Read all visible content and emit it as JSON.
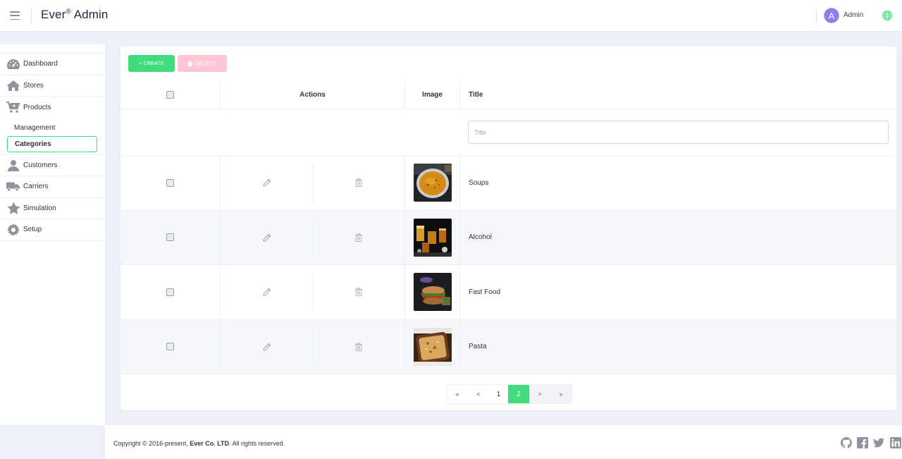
{
  "header": {
    "logo": "Ever",
    "logo_mark": "®",
    "logo_suffix": " Admin",
    "avatar_letter": "A",
    "user_name": "Admin"
  },
  "sidebar": {
    "items": [
      {
        "label": "Dashboard",
        "icon": "dashboard-icon"
      },
      {
        "label": "Stores",
        "icon": "home-icon"
      },
      {
        "label": "Products",
        "icon": "cart-icon"
      },
      {
        "label": "Customers",
        "icon": "person-icon"
      },
      {
        "label": "Carriers",
        "icon": "truck-icon"
      },
      {
        "label": "Simulation",
        "icon": "star-icon"
      },
      {
        "label": "Setup",
        "icon": "gear-icon"
      }
    ],
    "products_sub": [
      {
        "label": "Management",
        "active": false
      },
      {
        "label": "Categories",
        "active": true
      }
    ]
  },
  "toolbar": {
    "create_label": "+ CREATE",
    "delete_label": "DELETE"
  },
  "table": {
    "columns": {
      "actions": "Actions",
      "image": "Image",
      "title": "Title"
    },
    "filter_placeholder": "Title",
    "rows": [
      {
        "title": "Soups",
        "image": "soup-image"
      },
      {
        "title": "Alcohol",
        "image": "alcohol-image"
      },
      {
        "title": "Fast Food",
        "image": "fast-food-image"
      },
      {
        "title": "Pasta",
        "image": "pasta-image"
      }
    ]
  },
  "pagination": {
    "first": "«",
    "prev": "<",
    "pages": [
      "1",
      "2"
    ],
    "current": "2",
    "next": ">",
    "last": "»"
  },
  "footer": {
    "copyright_prefix": "Copyright © 2016-present, ",
    "company": "Ever Co. LTD",
    "copyright_suffix": ". All rights reserved.",
    "social": [
      "github-icon",
      "facebook-icon",
      "twitter-icon",
      "linkedin-icon"
    ]
  },
  "colors": {
    "accent": "#40dc7e",
    "delete": "#ffc6d4",
    "avatar": "#8c7cf0",
    "background": "#edf1f7"
  }
}
